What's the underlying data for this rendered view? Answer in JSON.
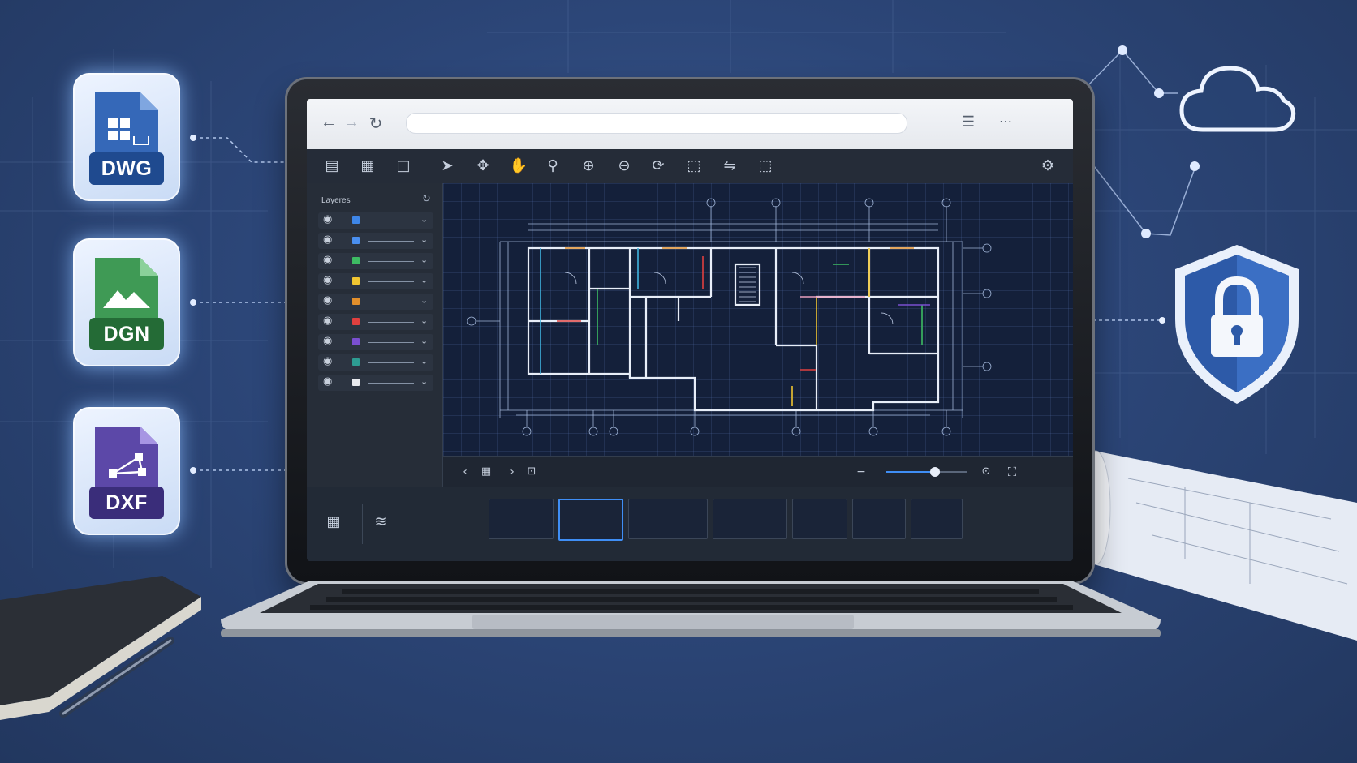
{
  "file_badges": [
    {
      "label": "DWG",
      "color": "#2f5fae",
      "icon": "grid-doc-icon"
    },
    {
      "label": "DGN",
      "color": "#2f7d45",
      "icon": "mountain-doc-icon"
    },
    {
      "label": "DXF",
      "color": "#4b3a8f",
      "icon": "nodes-doc-icon"
    }
  ],
  "browser": {
    "url": ""
  },
  "sidebar": {
    "title": "Layeres",
    "layers": [
      {
        "color": "#3e86e8"
      },
      {
        "color": "#4a8ff0"
      },
      {
        "color": "#3dbb63"
      },
      {
        "color": "#f0c531"
      },
      {
        "color": "#e28f2c"
      },
      {
        "color": "#e0403f"
      },
      {
        "color": "#7a4fd0"
      },
      {
        "color": "#2d9c92"
      },
      {
        "color": "#e8eaee"
      }
    ]
  },
  "toolbar": {
    "tools": [
      "layers-list-icon",
      "grid-view-icon",
      "single-view-icon",
      "select-arrow-icon",
      "pan-move-icon",
      "hand-icon",
      "zoom-icon",
      "zoom-in-icon",
      "zoom-out-icon",
      "rotate-icon",
      "select-box-icon",
      "measure-icon",
      "crop-icon"
    ]
  },
  "viewer": {
    "zoom_level": 0.6,
    "thumbnail_count": 7,
    "active_thumbnail": 1
  },
  "colors": {
    "accent": "#3f8ef5",
    "canvas": "#14203a"
  }
}
